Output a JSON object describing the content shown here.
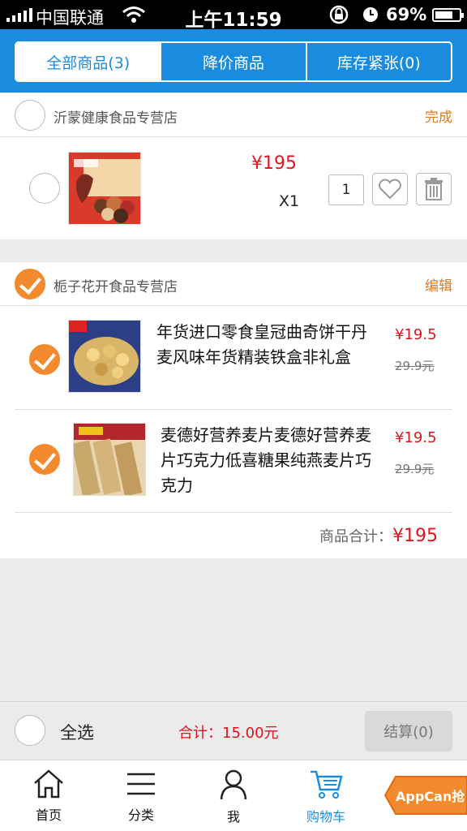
{
  "status_bar": {
    "carrier": "中国联通",
    "time": "上午11:59",
    "battery": "69%"
  },
  "tabs": [
    {
      "label": "全部商品(3)"
    },
    {
      "label": "降价商品"
    },
    {
      "label": "库存紧张(0)"
    }
  ],
  "stores": [
    {
      "name": "沂蒙健康食品专营店",
      "action": "完成",
      "item": {
        "price": "¥195",
        "count": "X1",
        "quantity": "1"
      }
    },
    {
      "name": "栀子花开食品专营店",
      "action": "编辑",
      "items": [
        {
          "title": "年货进口零食皇冠曲奇饼干丹麦风味年货精装铁盒非礼盒",
          "price": "¥19.5",
          "old_price": "29.9元"
        },
        {
          "title": "麦德好营养麦片麦德好营养麦片巧克力低喜糖果纯燕麦片巧克力",
          "price": "¥19.5",
          "old_price": "29.9元"
        }
      ],
      "subtotal_label": "商品合计：",
      "subtotal_value": "¥195"
    }
  ],
  "checkout": {
    "select_all": "全选",
    "total": "合计：15.00元",
    "pay": "结算(0)"
  },
  "nav": [
    {
      "label": "首页",
      "icon": "home-icon"
    },
    {
      "label": "分类",
      "icon": "menu-icon"
    },
    {
      "label": "我",
      "icon": "user-icon"
    },
    {
      "label": "购物车",
      "icon": "cart-icon"
    }
  ],
  "badge": "AppCan抢",
  "colors": {
    "primary": "#1a8ce0",
    "accent": "#f48a2e",
    "price": "#e0141e"
  }
}
